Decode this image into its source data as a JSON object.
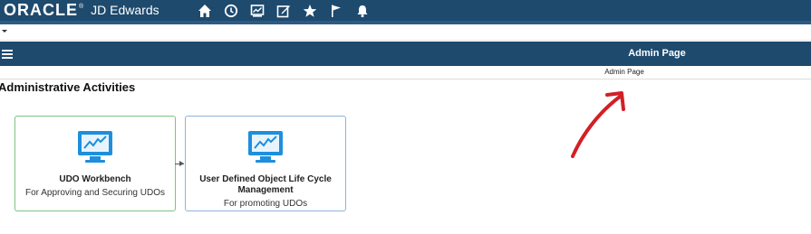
{
  "brand": {
    "oracle": "ORACLE",
    "registered": "®",
    "product": "JD Edwards"
  },
  "top_icons": [
    "home-icon",
    "recent-icon",
    "chart-icon",
    "edit-icon",
    "star-icon",
    "flag-icon",
    "bell-icon"
  ],
  "nav": {
    "title": "Admin Page"
  },
  "breadcrumb": {
    "current": "Admin Page"
  },
  "section": {
    "title": "Administrative Activities"
  },
  "tiles": [
    {
      "title": "UDO Workbench",
      "subtitle": "For Approving and Securing UDOs",
      "icon": "monitor-chart-icon"
    },
    {
      "title": "User Defined Object Life Cycle Management",
      "subtitle": "For promoting UDOs",
      "icon": "monitor-chart-icon"
    }
  ],
  "colors": {
    "header": "#1e4a6e",
    "tile1_border": "#7cc47f",
    "tile2_border": "#8db4dc",
    "icon_blue": "#1d8fdd",
    "annotation": "#d21f26"
  }
}
